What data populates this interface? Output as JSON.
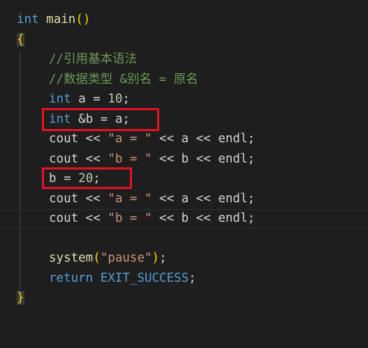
{
  "lines": {
    "l1": {
      "kw": "int",
      "name": "main",
      "parens": "()"
    },
    "l2": {
      "brace_open": "{"
    },
    "l3": {
      "comment": "//引用基本语法"
    },
    "l4": {
      "comment": "//数据类型 &别名 = 原名"
    },
    "l5": {
      "kw": "int",
      "rest": "a = ",
      "num": "10",
      "end": ";"
    },
    "l6": {
      "kw": "int",
      "rest": "&b = a;"
    },
    "l7": {
      "a": "cout << ",
      "str": "\"a = \"",
      "b": " << a << endl;"
    },
    "l8": {
      "a": "cout << ",
      "str": "\"b = \"",
      "b": " << b << endl;"
    },
    "l9": {
      "a": "b = ",
      "num": "20",
      "end": ";"
    },
    "l10": {
      "a": "cout << ",
      "str": "\"a = \"",
      "b": " << a << endl;"
    },
    "l11": {
      "a": "cout << ",
      "str": "\"b = \"",
      "b": " << b << endl;"
    },
    "l13": {
      "fn": "system",
      "p1": "(",
      "str": "\"pause\"",
      "p2": ")",
      "end": ";"
    },
    "l14": {
      "kw": "return",
      "macro": "EXIT_SUCCESS",
      "end": ";"
    },
    "l15": {
      "brace_close": "}"
    }
  },
  "colors": {
    "background": "#1e1e1e",
    "keyword": "#569cd6",
    "string": "#ce9178",
    "number": "#b5cea8",
    "comment": "#6a9955",
    "function": "#dcdcaa",
    "highlight_box": "#e81123"
  }
}
